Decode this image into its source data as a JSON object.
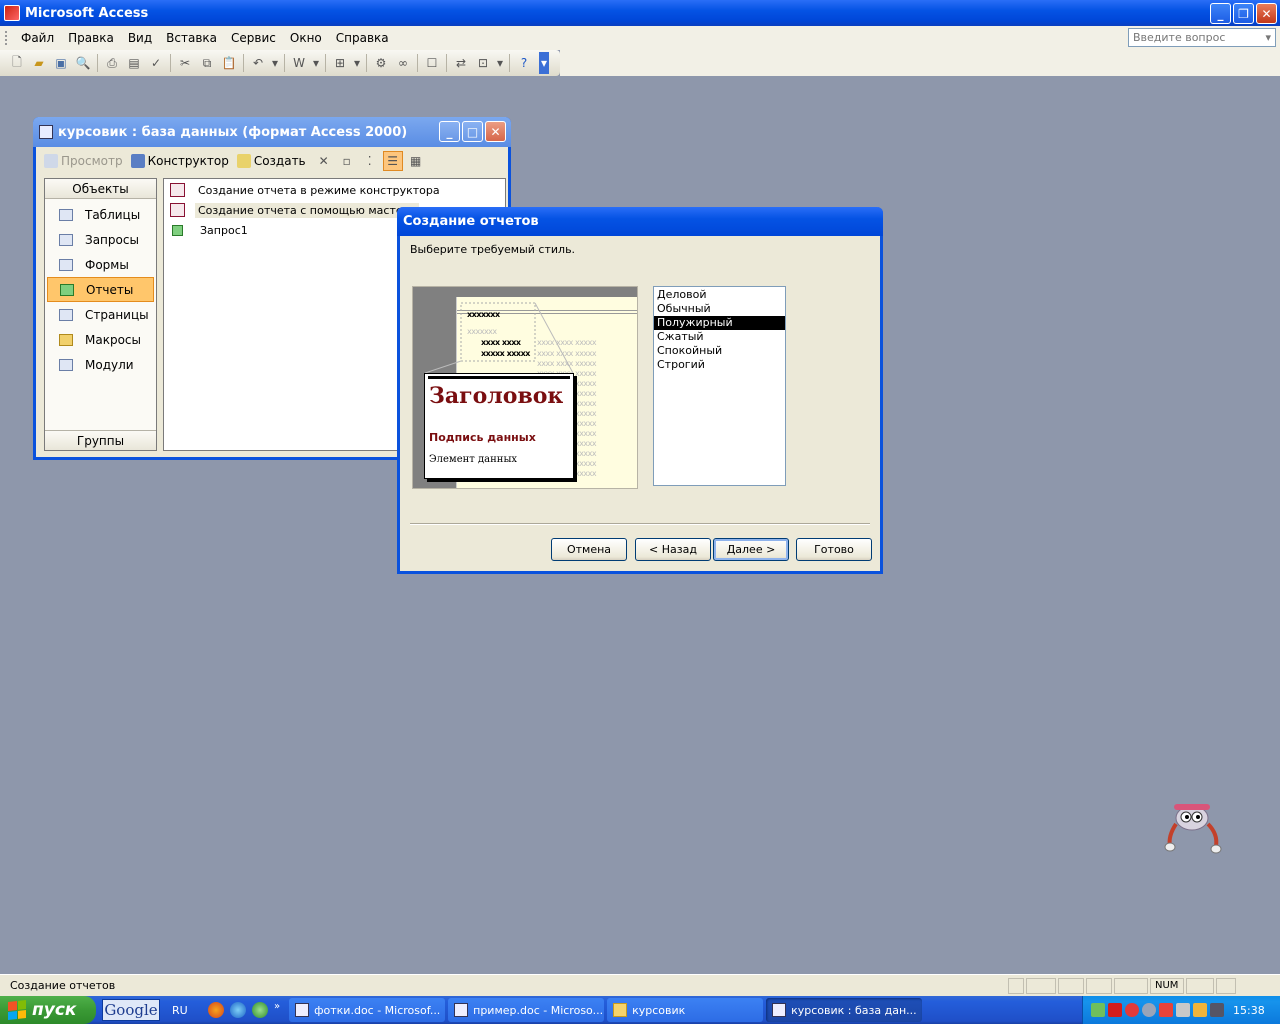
{
  "app": {
    "title": "Microsoft Access"
  },
  "menubar": {
    "items": [
      "Файл",
      "Правка",
      "Вид",
      "Вставка",
      "Сервис",
      "Окно",
      "Справка"
    ],
    "help_placeholder": "Введите вопрос"
  },
  "db_window": {
    "title": "курсовик : база данных (формат Access 2000)",
    "toolbar": {
      "preview": "Просмотр",
      "design": "Конструктор",
      "create": "Создать"
    },
    "objects_header": "Объекты",
    "groups_footer": "Группы",
    "object_types": [
      "Таблицы",
      "Запросы",
      "Формы",
      "Отчеты",
      "Страницы",
      "Макросы",
      "Модули"
    ],
    "selected_type": "Отчеты",
    "list": [
      "Создание отчета в режиме конструктора",
      "Создание отчета с помощью мастера",
      "Запрос1"
    ]
  },
  "wizard": {
    "title": "Создание отчетов",
    "prompt": "Выберите требуемый стиль.",
    "preview": {
      "heading": "Заголовок",
      "subheading": "Подпись данных",
      "item": "Элемент данных",
      "x_dark1": "xxxxxxx",
      "x_light1": "xxxxxxx",
      "x_dark2": "xxxx xxxx",
      "x_dark3": "xxxxx xxxxx",
      "x_light_row": "xxxx xxxx xxxxx"
    },
    "styles": [
      "Деловой",
      "Обычный",
      "Полужирный",
      "Сжатый",
      "Спокойный",
      "Строгий"
    ],
    "selected_style": "Полужирный",
    "buttons": {
      "cancel": "Отмена",
      "back": "< Назад",
      "next": "Далее >",
      "finish": "Готово"
    }
  },
  "statusbar": {
    "text": "Создание отчетов",
    "num": "NUM"
  },
  "taskbar": {
    "start": "пуск",
    "google": "Google",
    "lang": "RU",
    "tasks": [
      "фотки.doc - Microsof...",
      "пример.doc - Microso...",
      "курсовик",
      "курсовик : база дан..."
    ],
    "clock": "15:38"
  },
  "colors": {
    "xp_blue": "#0a52dd",
    "selection_orange": "#ffc66b",
    "preview_heading": "#7a0e10"
  }
}
